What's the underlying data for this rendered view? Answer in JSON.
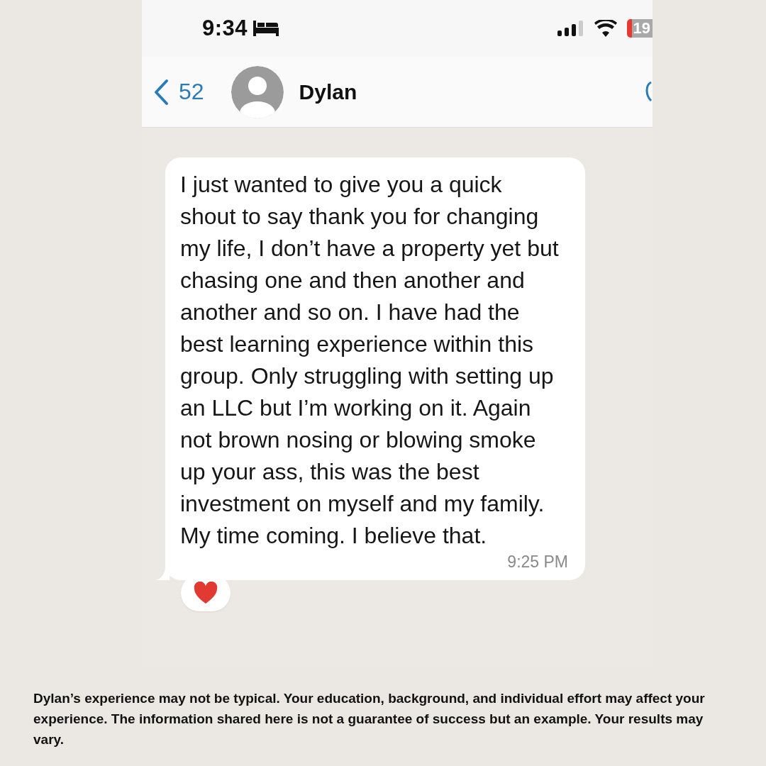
{
  "status_bar": {
    "time": "9:34",
    "battery": "19"
  },
  "header": {
    "back_count": "52",
    "contact_name": "Dylan"
  },
  "message": {
    "text": "I just wanted to give you a quick shout to say thank you for changing my life, I don’t have a property yet but chasing one and then another and another and so on. I have had the best learning experience within this group. Only struggling with setting up an LLC but I’m working on it. Again not brown nosing or blowing smoke up your ass, this was the best investment on myself and my family. My time coming. I believe that.",
    "time": "9:25 PM"
  },
  "disclaimer": "Dylan’s experience may not be typical. Your education, background, and individual effort may affect your experience. The information shared here is not a guarantee of success but an example. Your results may vary."
}
